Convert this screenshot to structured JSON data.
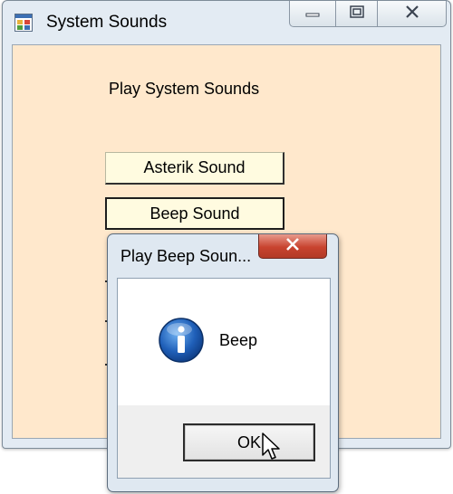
{
  "main_window": {
    "title": "System Sounds",
    "heading": "Play System Sounds",
    "buttons": [
      {
        "label": "Asterik Sound"
      },
      {
        "label": "Beep Sound"
      }
    ],
    "background_color": "#ffe8cc"
  },
  "message_box": {
    "title": "Play Beep Soun...",
    "message": "Beep",
    "icon": "info-icon",
    "ok_label": "OK"
  },
  "icons": {
    "app": "app-form-icon",
    "minimize": "minimize-icon",
    "maximize": "maximize-icon",
    "close": "close-icon",
    "cursor": "mouse-pointer-icon"
  },
  "colors": {
    "close_red": "#c8432f",
    "info_blue": "#1f5fb8",
    "frame": "#e3ebf3"
  }
}
